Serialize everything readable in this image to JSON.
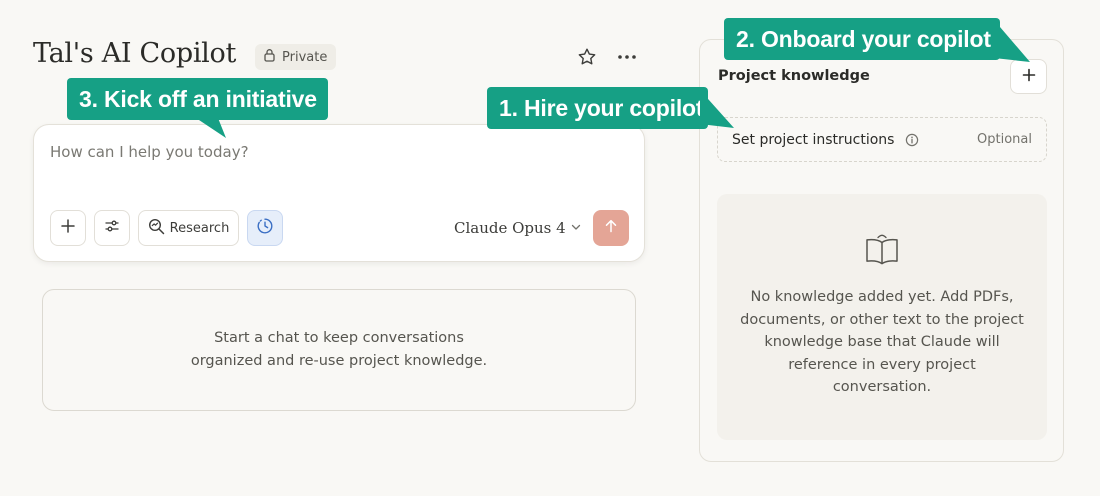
{
  "header": {
    "title": "Tal's AI Copilot",
    "private_label": "Private",
    "star_icon": "star-icon",
    "more_icon": "more-icon"
  },
  "composer": {
    "placeholder": "How can I help you today?",
    "research_label": "Research",
    "model_label": "Claude Opus 4",
    "send_color": "#e4a596"
  },
  "chats": {
    "empty_line1": "Start a chat to keep conversations",
    "empty_line2": "organized and re-use project knowledge."
  },
  "knowledge": {
    "title": "Project knowledge",
    "instructions_label": "Set project instructions",
    "instructions_optional": "Optional",
    "empty_text": "No knowledge added yet. Add PDFs, documents, or other text to the project knowledge base that Claude will reference in every project conversation."
  },
  "callouts": {
    "kick_off": "3. Kick off an initiative",
    "hire": "1. Hire your copilot",
    "onboard": "2. Onboard your copilot",
    "color": "#16a085"
  }
}
